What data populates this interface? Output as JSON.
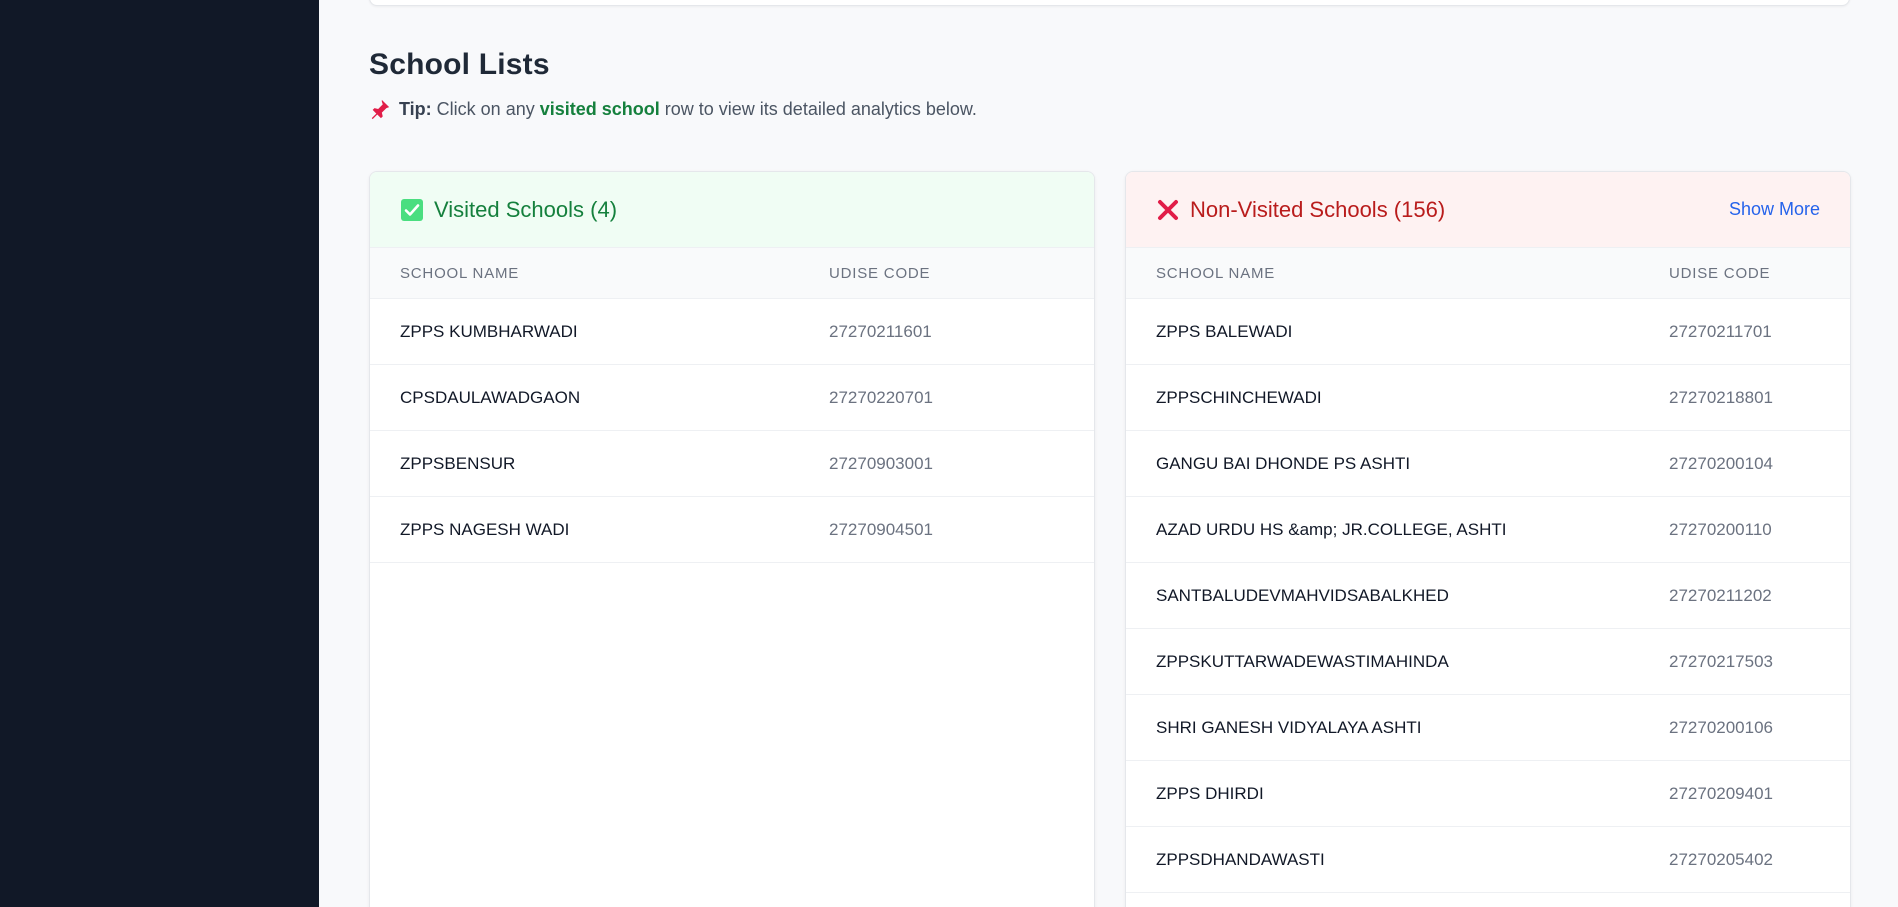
{
  "section": {
    "title": "School Lists",
    "tip_label": "Tip:",
    "tip_before": "Click on any",
    "tip_highlight": "visited school",
    "tip_after": "row to view its detailed analytics below."
  },
  "visited": {
    "title": "Visited Schools (4)",
    "icon": "check-box-icon",
    "col_name": "SCHOOL NAME",
    "col_code": "UDISE CODE",
    "rows": [
      {
        "name": "ZPPS KUMBHARWADI",
        "code": "27270211601"
      },
      {
        "name": "CPSDAULAWADGAON",
        "code": "27270220701"
      },
      {
        "name": "ZPPSBENSUR",
        "code": "27270903001"
      },
      {
        "name": "ZPPS NAGESH WADI",
        "code": "27270904501"
      }
    ]
  },
  "nonvisited": {
    "title": "Non-Visited Schools (156)",
    "icon": "cross-mark-icon",
    "show_more": "Show More",
    "col_name": "SCHOOL NAME",
    "col_code": "UDISE CODE",
    "rows": [
      {
        "name": "ZPPS BALEWADI",
        "code": "27270211701"
      },
      {
        "name": "ZPPSCHINCHEWADI",
        "code": "27270218801"
      },
      {
        "name": "GANGU BAI DHONDE PS ASHTI",
        "code": "27270200104"
      },
      {
        "name": "AZAD URDU HS &amp; JR.COLLEGE, ASHTI",
        "code": "27270200110"
      },
      {
        "name": "SANTBALUDEVMAHVIDSABALKHED",
        "code": "27270211202"
      },
      {
        "name": "ZPPSKUTTARWADEWASTIMAHINDA",
        "code": "27270217503"
      },
      {
        "name": "SHRI GANESH VIDYALAYA ASHTI",
        "code": "27270200106"
      },
      {
        "name": "ZPPS DHIRDI",
        "code": "27270209401"
      },
      {
        "name": "ZPPSDHANDAWASTI",
        "code": "27270205402"
      }
    ]
  },
  "colors": {
    "sidebar": "#111827",
    "visited_accent": "#15803d",
    "nonvisited_accent": "#b91c1c",
    "link": "#2563eb"
  }
}
